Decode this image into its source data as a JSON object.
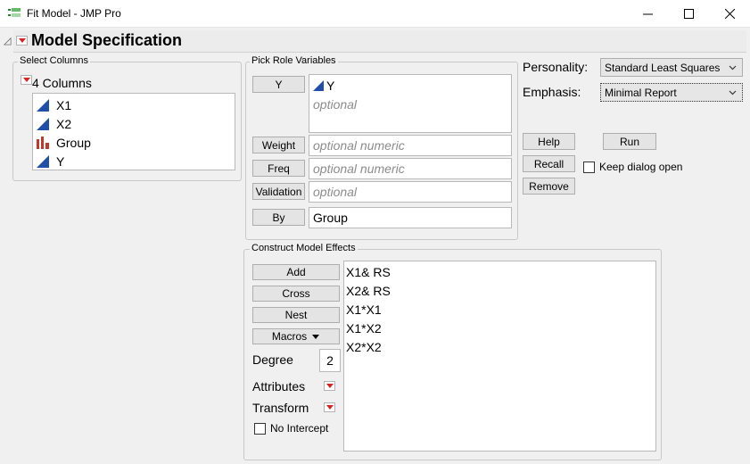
{
  "window": {
    "title": "Fit Model - JMP Pro"
  },
  "header": {
    "title": "Model Specification"
  },
  "select_columns": {
    "label": "Select Columns",
    "count_label": "4 Columns",
    "columns": [
      {
        "name": "X1",
        "icon": "continuous-icon"
      },
      {
        "name": "X2",
        "icon": "continuous-icon"
      },
      {
        "name": "Group",
        "icon": "nominal-icon"
      },
      {
        "name": "Y",
        "icon": "continuous-icon"
      }
    ]
  },
  "pick_roles": {
    "label": "Pick Role Variables",
    "y_button": "Y",
    "y_value": "Y",
    "y_placeholder": "optional",
    "weight_button": "Weight",
    "weight_placeholder": "optional numeric",
    "freq_button": "Freq",
    "freq_placeholder": "optional numeric",
    "validation_button": "Validation",
    "validation_placeholder": "optional",
    "by_button": "By",
    "by_value": "Group"
  },
  "options": {
    "personality_label": "Personality:",
    "personality_value": "Standard Least Squares",
    "emphasis_label": "Emphasis:",
    "emphasis_value": "Minimal Report",
    "help_button": "Help",
    "run_button": "Run",
    "recall_button": "Recall",
    "remove_button": "Remove",
    "keep_open_label": "Keep dialog open"
  },
  "construct": {
    "label": "Construct Model Effects",
    "add_button": "Add",
    "cross_button": "Cross",
    "nest_button": "Nest",
    "macros_button": "Macros",
    "degree_label": "Degree",
    "degree_value": "2",
    "attributes_label": "Attributes",
    "transform_label": "Transform",
    "no_intercept_label": "No Intercept",
    "effects": [
      "X1& RS",
      "X2& RS",
      "X1*X1",
      "X1*X2",
      "X2*X2"
    ]
  },
  "colors": {
    "accent_red": "#dd2222",
    "continuous_blue": "#1f4fa8",
    "nominal_red": "#c0392b"
  }
}
